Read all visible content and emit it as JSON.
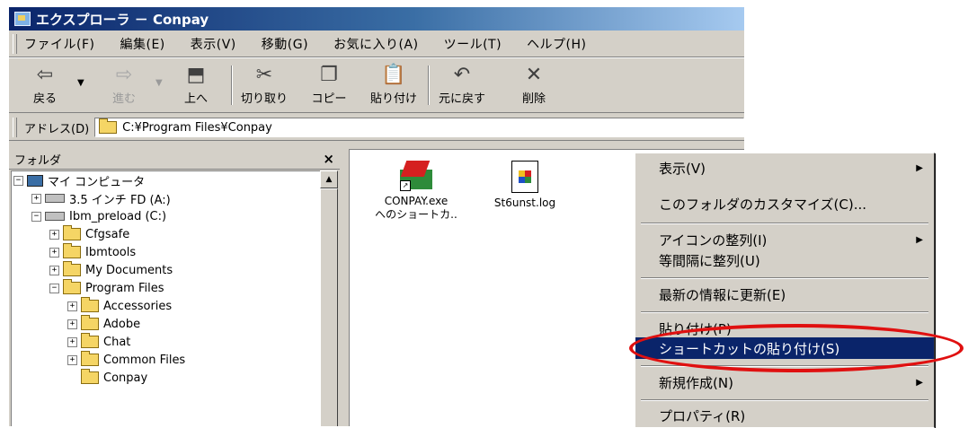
{
  "window": {
    "title": "エクスプローラ － Conpay"
  },
  "menubar": {
    "items": [
      "ファイル(F)",
      "編集(E)",
      "表示(V)",
      "移動(G)",
      "お気に入り(A)",
      "ツール(T)",
      "ヘルプ(H)"
    ]
  },
  "toolbar": {
    "back_label": "戻る",
    "forward_label": "進む",
    "up_label": "上へ",
    "cut_label": "切り取り",
    "copy_label": "コピー",
    "paste_label": "貼り付け",
    "undo_label": "元に戻す",
    "delete_label": "削除"
  },
  "address": {
    "label": "アドレス(D)",
    "value": "C:¥Program Files¥Conpay"
  },
  "folders": {
    "header": "フォルダ",
    "close": "×",
    "tree": [
      {
        "label": "マイ コンピュータ",
        "expander": "−"
      },
      {
        "label": "3.5 インチ FD (A:)",
        "expander": "+"
      },
      {
        "label": "Ibm_preload (C:)",
        "expander": "−"
      },
      {
        "label": "Cfgsafe",
        "expander": "+"
      },
      {
        "label": "Ibmtools",
        "expander": "+"
      },
      {
        "label": "My Documents",
        "expander": "+"
      },
      {
        "label": "Program Files",
        "expander": "−"
      },
      {
        "label": "Accessories",
        "expander": "+"
      },
      {
        "label": "Adobe",
        "expander": "+"
      },
      {
        "label": "Chat",
        "expander": "+"
      },
      {
        "label": "Common Files",
        "expander": "+"
      },
      {
        "label": "Conpay",
        "expander": ""
      }
    ]
  },
  "files": [
    {
      "name_line1": "CONPAY.exe",
      "name_line2": "へのショートカ..",
      "icon": "shortcut-exe-icon"
    },
    {
      "name_line1": "St6unst.log",
      "name_line2": "",
      "icon": "log-file-icon"
    }
  ],
  "context_menu": {
    "items": [
      {
        "label": "表示(V)",
        "submenu": true
      },
      {
        "label": "このフォルダのカスタマイズ(C)...",
        "submenu": false
      },
      {
        "label": "アイコンの整列(I)",
        "submenu": true
      },
      {
        "label": "等間隔に整列(U)",
        "submenu": false
      },
      {
        "label": "最新の情報に更新(E)",
        "submenu": false
      },
      {
        "label": "貼り付け(P)",
        "submenu": false
      },
      {
        "label": "ショートカットの貼り付け(S)",
        "submenu": false,
        "selected": true
      },
      {
        "label": "新規作成(N)",
        "submenu": true
      },
      {
        "label": "プロパティ(R)",
        "submenu": false
      }
    ],
    "submenu_arrow": "▶"
  },
  "colors": {
    "title_start": "#0a246a",
    "selection": "#0a246a",
    "highlight_ring": "#e01010",
    "face": "#d4d0c8"
  }
}
